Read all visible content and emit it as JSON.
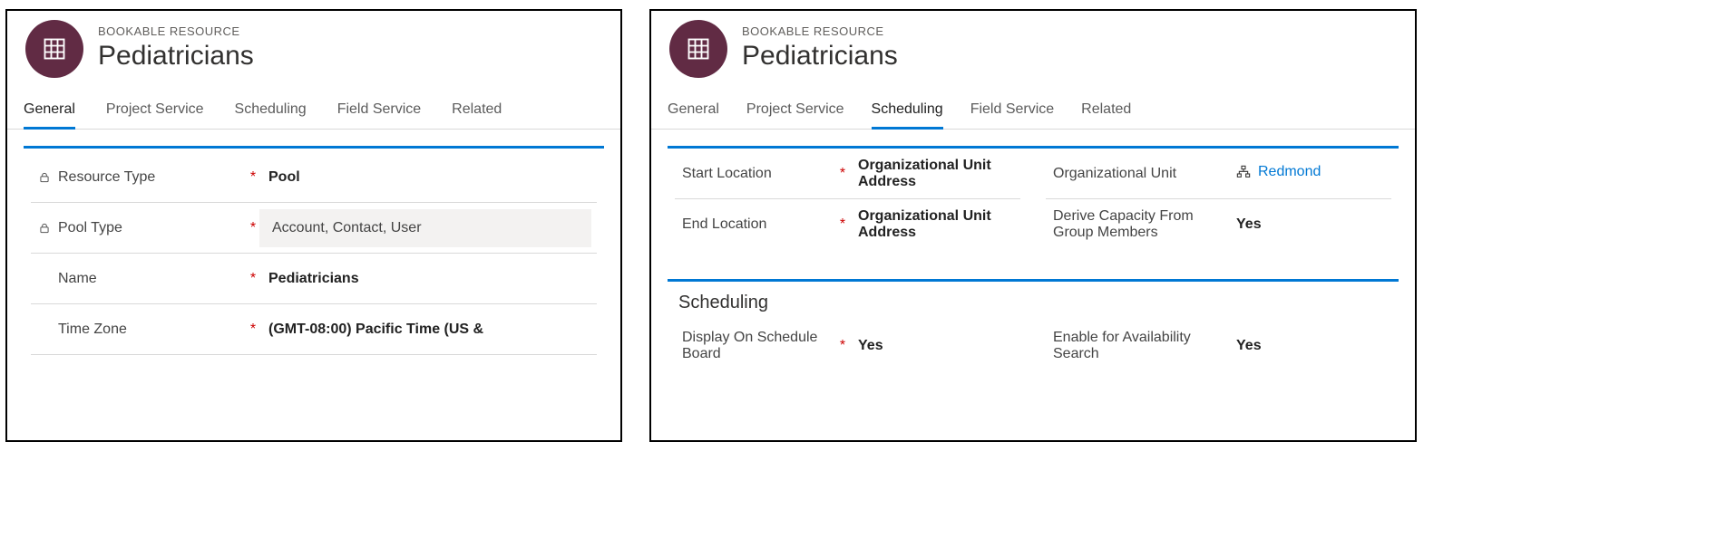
{
  "left": {
    "eyebrow": "BOOKABLE RESOURCE",
    "title": "Pediatricians",
    "tabs": {
      "general": "General",
      "project_service": "Project Service",
      "scheduling": "Scheduling",
      "field_service": "Field Service",
      "related": "Related"
    },
    "fields": {
      "resource_type": {
        "label": "Resource Type",
        "value": "Pool"
      },
      "pool_type": {
        "label": "Pool Type",
        "value": "Account, Contact, User"
      },
      "name": {
        "label": "Name",
        "value": "Pediatricians"
      },
      "time_zone": {
        "label": "Time Zone",
        "value": "(GMT-08:00) Pacific Time (US &"
      }
    }
  },
  "right": {
    "eyebrow": "BOOKABLE RESOURCE",
    "title": "Pediatricians",
    "tabs": {
      "general": "General",
      "project_service": "Project Service",
      "scheduling": "Scheduling",
      "field_service": "Field Service",
      "related": "Related"
    },
    "top": {
      "start_location": {
        "label": "Start Location",
        "value": "Organizational Unit Address"
      },
      "end_location": {
        "label": "End Location",
        "value": "Organizational Unit Address"
      },
      "org_unit": {
        "label": "Organizational Unit",
        "value": "Redmond"
      },
      "derive_capacity": {
        "label": "Derive Capacity From Group Members",
        "value": "Yes"
      }
    },
    "sched": {
      "title": "Scheduling",
      "display_on_board": {
        "label": "Display On Schedule Board",
        "value": "Yes"
      },
      "enable_avail": {
        "label": "Enable for Availability Search",
        "value": "Yes"
      }
    }
  }
}
